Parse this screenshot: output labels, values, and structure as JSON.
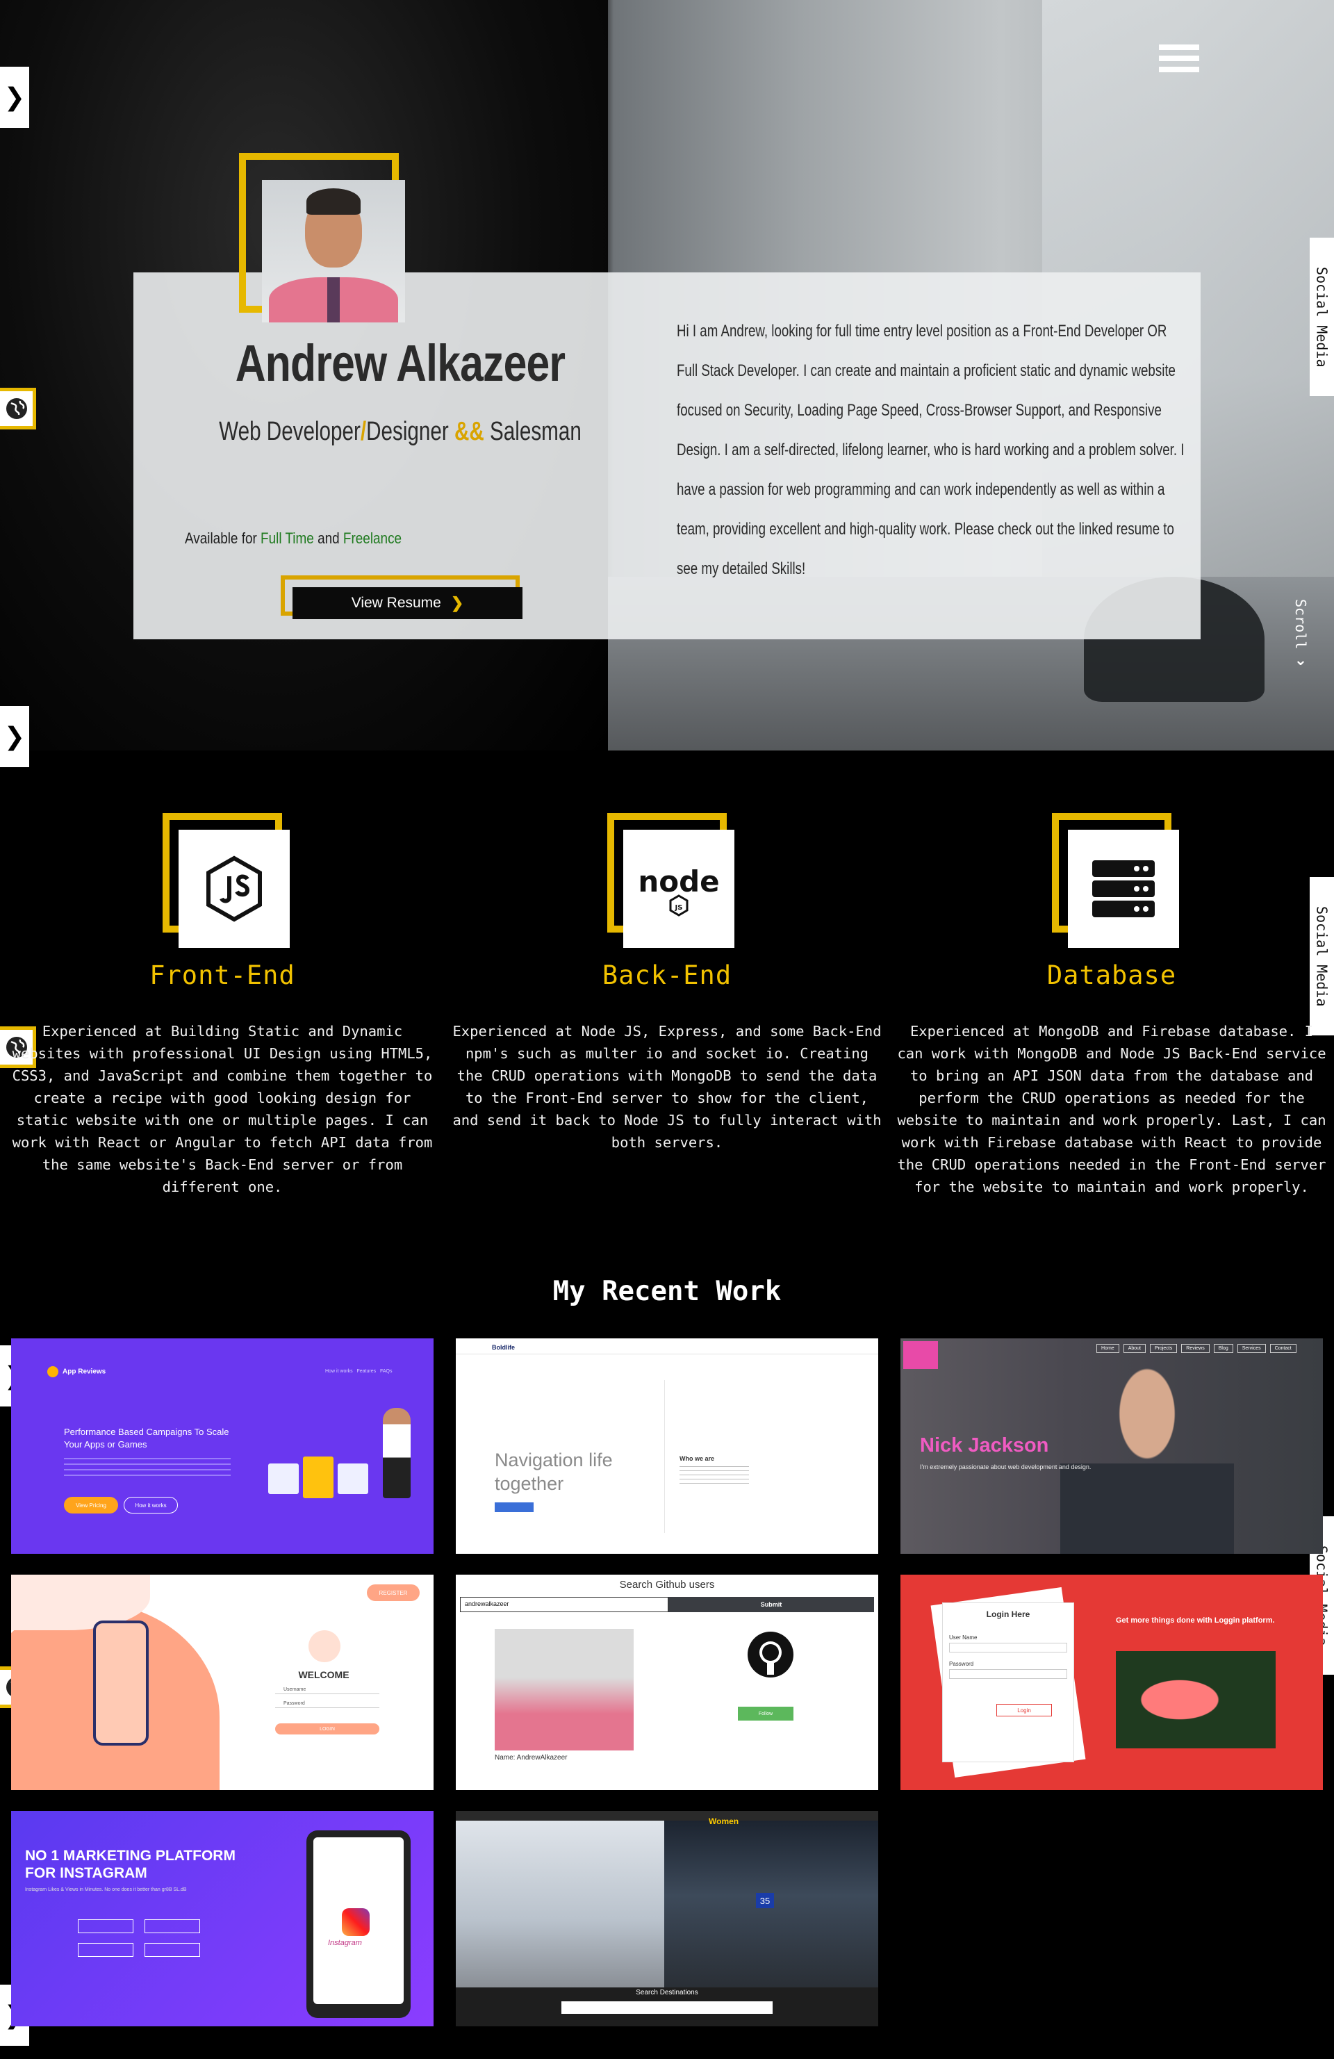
{
  "hero": {
    "name": "Andrew Alkazeer",
    "role_1": "Web Developer",
    "role_sep": "/",
    "role_2": "Designer",
    "role_amp": "&&",
    "role_3": "Salesman",
    "avail_prefix": "Available for",
    "avail_fulltime": "Full Time",
    "avail_and": "and",
    "avail_freelance": "Freelance",
    "resume_label": "View Resume",
    "bio": "Hi I am Andrew, looking for full time entry level position as a Front-End Developer OR Full Stack Developer. I can create and maintain a proficient static and dynamic website focused on Security, Loading Page Speed, Cross-Browser Support, and Responsive Design. I am a self-directed, lifelong learner, who is hard working and a problem solver. I have a passion for web programming and can work independently as well as within a team, providing excellent and high-quality work. Please check out the linked resume to see my detailed Skills!",
    "scroll_label": "Scroll"
  },
  "side": {
    "social_label": "Social Media"
  },
  "skills": [
    {
      "title": "Front-End",
      "icon": "js-icon",
      "desc": "Experienced at Building Static and Dynamic websites with professional UI Design using HTML5, CSS3, and JavaScript and combine them together to create a recipe with good looking design for static website with one or multiple pages. I can work with React or Angular to fetch API data from the same website's Back-End server or from different one."
    },
    {
      "title": "Back-End",
      "icon": "nodejs-icon",
      "desc": "Experienced at Node JS, Express, and some Back-End npm's such as multer io and socket io. Creating the CRUD operations with MongoDB to send the data to the Front-End server to show for the client, and send it back to Node JS to fully interact with both servers."
    },
    {
      "title": "Database",
      "icon": "server-icon",
      "desc": "Experienced at MongoDB and Firebase database. I can work with MongoDB and Node JS Back-End service to bring an API JSON data from the database and perform the CRUD operations as needed for the website to maintain and work properly. Last, I can work with Firebase database with React to provide the CRUD operations needed in the Front-End server for the website to maintain and work properly."
    }
  ],
  "work": {
    "title": "My Recent Work",
    "projects": [
      {
        "brand": "App Reviews",
        "nav": "How it works   Features   FAQs",
        "headline": "Performance Based Campaigns To Scale Your Apps or Games",
        "btn1": "View Pricing",
        "btn2": "How it works"
      },
      {
        "brand": "Boldlife",
        "headline": "Navigation life together",
        "sub": "Who we are"
      },
      {
        "name": "Nick Jackson",
        "tagline": "I'm extremely passionate about web development and design.",
        "nav": [
          "Home",
          "About",
          "Projects",
          "Reviews",
          "Blog",
          "Services",
          "Contact"
        ]
      },
      {
        "welcome": "WELCOME",
        "username": "Username",
        "password": "Password",
        "login": "LOGIN",
        "register": "REGISTER"
      },
      {
        "title": "Search Github users",
        "query": "andrewalkazeer",
        "submit": "Submit",
        "user": "Name: AndrewAlkazeer",
        "follow": "Follow"
      },
      {
        "title": "Login Here",
        "user_label": "User Name",
        "pass_label": "Password",
        "btn": "Login",
        "promo": "Get more things done with Loggin platform."
      },
      {
        "headline": "NO 1 MARKETING PLATFORM FOR INSTAGRAM",
        "sub": "Instagram Likes & Views in Minutes. No one does it better than gr8B SL.dB",
        "logo": "Instagram"
      },
      {
        "search": "Search Destinations",
        "gate": "35",
        "sign": "Women"
      }
    ]
  }
}
